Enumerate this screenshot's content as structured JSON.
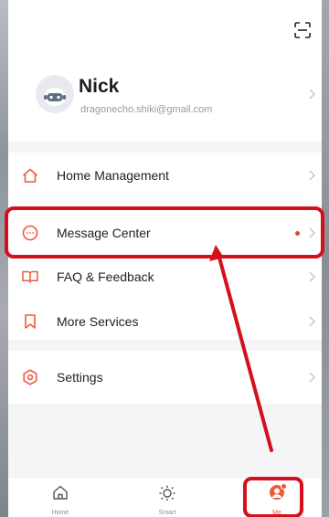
{
  "header": {
    "scan_icon": "scan-icon"
  },
  "user": {
    "name": "Nick",
    "email": "dragonecho.shiki@gmail.com",
    "avatar_icon": "robot-avatar-icon"
  },
  "menu": {
    "items": [
      {
        "label": "Home Management",
        "icon": "house-icon"
      },
      {
        "label": "Message Center",
        "icon": "chat-bubble-icon",
        "has_dot": true
      },
      {
        "label": "FAQ & Feedback",
        "icon": "book-icon"
      },
      {
        "label": "More Services",
        "icon": "bookmark-icon"
      },
      {
        "label": "Settings",
        "icon": "gear-icon"
      }
    ]
  },
  "tabbar": {
    "tabs": [
      {
        "label": "Home",
        "icon": "home-icon",
        "active": false
      },
      {
        "label": "Smart",
        "icon": "sun-icon",
        "active": false
      },
      {
        "label": "Me",
        "icon": "person-icon",
        "active": true
      }
    ]
  },
  "colors": {
    "accent": "#ee5a3a",
    "highlight": "#d4101d",
    "dot": "#e8442e"
  }
}
